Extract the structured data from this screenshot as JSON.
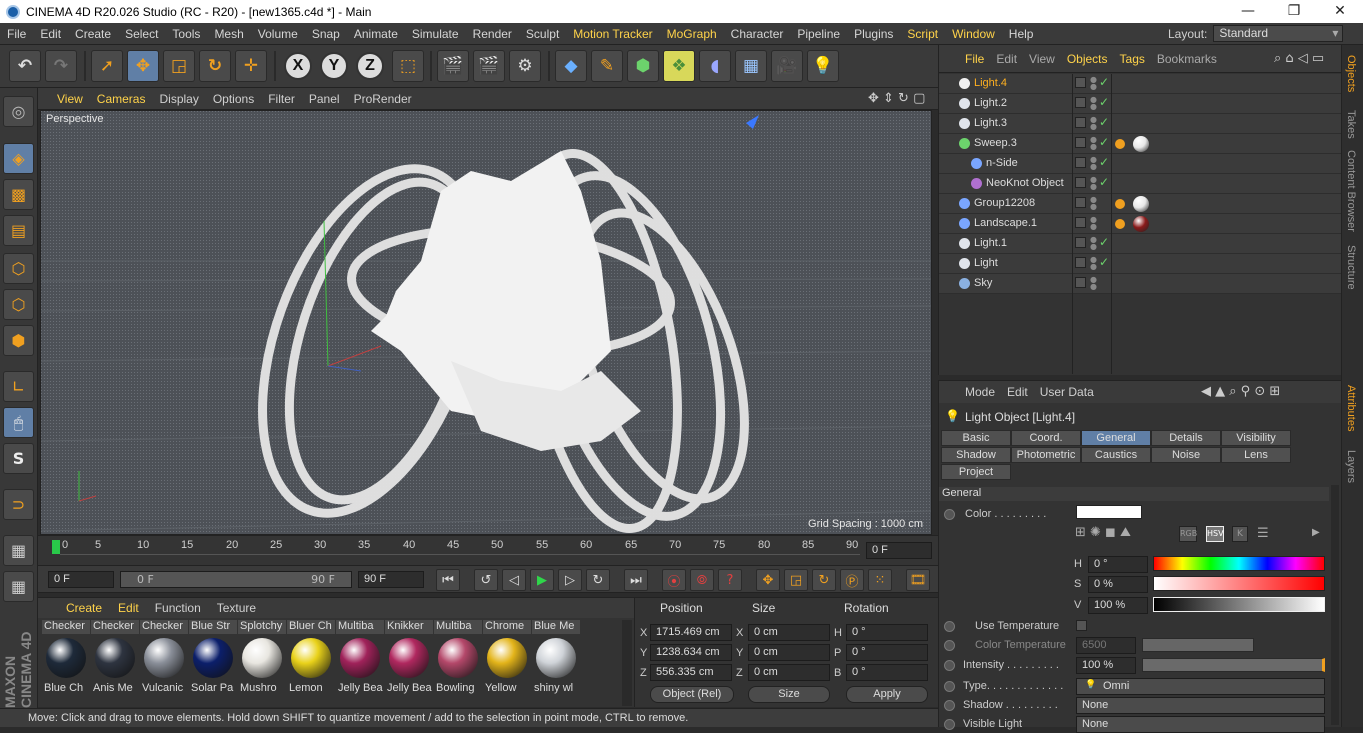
{
  "window": {
    "title": "CINEMA 4D R20.026 Studio (RC - R20) - [new1365.c4d *] - Main",
    "minimize": "—",
    "maximize": "❐",
    "close": "✕"
  },
  "menubar": [
    "File",
    "Edit",
    "Create",
    "Select",
    "Tools",
    "Mesh",
    "Volume",
    "Snap",
    "Animate",
    "Simulate",
    "Render",
    "Sculpt",
    "Motion Tracker",
    "MoGraph",
    "Character",
    "Pipeline",
    "Plugins",
    "Script",
    "Window",
    "Help"
  ],
  "layout": {
    "label": "Layout:",
    "value": "Standard"
  },
  "toolbar": {
    "x": "X",
    "y": "Y",
    "z": "Z"
  },
  "viewport": {
    "menu": [
      "View",
      "Cameras",
      "Display",
      "Options",
      "Filter",
      "Panel",
      "ProRender"
    ],
    "camera": "Perspective",
    "grid_spacing": "Grid Spacing : 1000 cm"
  },
  "timeline": {
    "ticks": [
      "0",
      "5",
      "10",
      "15",
      "20",
      "25",
      "30",
      "35",
      "40",
      "45",
      "50",
      "55",
      "60",
      "65",
      "70",
      "75",
      "80",
      "85",
      "90"
    ],
    "current": "0 F"
  },
  "playbar": {
    "start": "0 F",
    "range_start": "0 F",
    "range_end": "90 F",
    "end": "90 F"
  },
  "materials": {
    "menu": [
      "Create",
      "Edit",
      "Function",
      "Texture"
    ],
    "top_row": [
      "Checker",
      "Checker",
      "Checker",
      "Blue Str",
      "Splotchy",
      "Bluer Ch",
      "Multiba",
      "Knikker",
      "Multiba",
      "Chrome",
      "Blue Me"
    ],
    "bottom_row": [
      "Blue Ch",
      "Anis Me",
      "Vulcanic",
      "Solar Pa",
      "Mushro",
      "Lemon",
      "Jelly Bea",
      "Jelly Bea",
      "Bowling",
      "Yellow",
      "shiny wl"
    ],
    "colors": [
      "#1e2a3a",
      "#2e3440",
      "#8a8f99",
      "#0c1f6b",
      "#e8e6e0",
      "#e9d21a",
      "#a0225a",
      "#b0285f",
      "#b4486a",
      "#e3b41a",
      "#cfd3d8"
    ]
  },
  "coords": {
    "headers": {
      "position": "Position",
      "size": "Size",
      "rotation": "Rotation"
    },
    "rows": [
      {
        "axis": "X",
        "pos": "1715.469 cm",
        "size_axis": "X",
        "size": "0 cm",
        "rot_axis": "H",
        "rot": "0 °"
      },
      {
        "axis": "Y",
        "pos": "1238.634 cm",
        "size_axis": "Y",
        "size": "0 cm",
        "rot_axis": "P",
        "rot": "0 °"
      },
      {
        "axis": "Z",
        "pos": "556.335 cm",
        "size_axis": "Z",
        "size": "0 cm",
        "rot_axis": "B",
        "rot": "0 °"
      }
    ],
    "mode": "Object (Rel)",
    "size_mode": "Size",
    "apply": "Apply"
  },
  "status": "Move: Click and drag to move elements. Hold down SHIFT to quantize movement / add to the selection in point mode, CTRL to remove.",
  "objects": {
    "menu": [
      "File",
      "Edit",
      "View",
      "Objects",
      "Tags",
      "Bookmarks"
    ],
    "items": [
      {
        "name": "Light.4",
        "indent": 0,
        "selected": true
      },
      {
        "name": "Light.2",
        "indent": 0
      },
      {
        "name": "Light.3",
        "indent": 0
      },
      {
        "name": "Sweep.3",
        "indent": 0
      },
      {
        "name": "n-Side",
        "indent": 1
      },
      {
        "name": "NeoKnot Object",
        "indent": 1
      },
      {
        "name": "Group12208",
        "indent": 0
      },
      {
        "name": "Landscape.1",
        "indent": 0
      },
      {
        "name": "Light.1",
        "indent": 0
      },
      {
        "name": "Light",
        "indent": 0
      },
      {
        "name": "Sky",
        "indent": 0
      }
    ],
    "check": "✓"
  },
  "attributes": {
    "menu": [
      "Mode",
      "Edit",
      "User Data"
    ],
    "title": "Light Object [Light.4]",
    "tabs_row1": [
      "Basic",
      "Coord.",
      "General",
      "Details",
      "Visibility"
    ],
    "tabs_row2": [
      "Shadow",
      "Photometric",
      "Caustics",
      "Noise",
      "Lens"
    ],
    "tabs_row3": [
      "Project"
    ],
    "active_tab": "General",
    "section": "General",
    "color_label": "Color . . . . . . . . .",
    "h_label": "H",
    "h_value": "0 °",
    "s_label": "S",
    "s_value": "0 %",
    "v_label": "V",
    "v_value": "100 %",
    "use_temp": "Use Temperature",
    "color_temp": "Color Temperature",
    "color_temp_value": "6500",
    "intensity": "Intensity . . . . . . . . .",
    "intensity_value": "100 %",
    "type": "Type. . . . . . . . . . . . .",
    "type_value": "Omni",
    "shadow": "Shadow . . . . . . . . .",
    "shadow_value": "None",
    "visible_light": "Visible Light",
    "visible_value": "None",
    "mode_buttons": {
      "rgb": "RGB",
      "hsv": "HSV",
      "k": "K"
    }
  },
  "right_tabs": [
    "Objects",
    "Takes",
    "Content Browser",
    "Structure",
    "Attributes",
    "Layers"
  ]
}
